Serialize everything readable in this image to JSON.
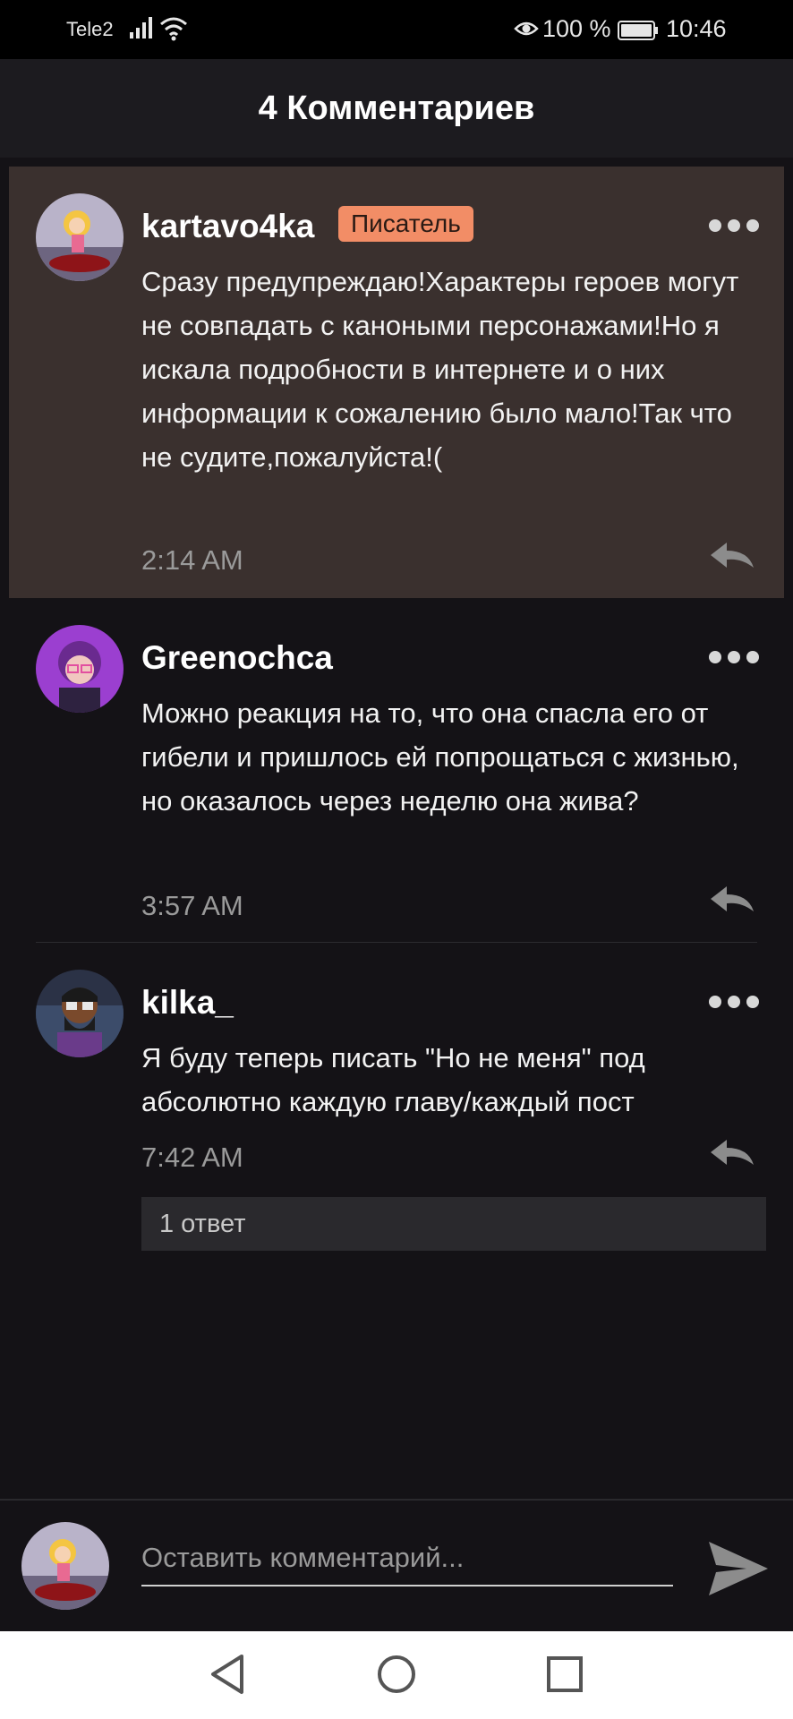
{
  "status_bar": {
    "carrier": "Tele2",
    "battery_percent": "100 %",
    "time": "10:46"
  },
  "header": {
    "title": "4 Комментариев"
  },
  "comments": [
    {
      "username": "kartavo4ka",
      "badge": "Писатель",
      "text": "Сразу предупреждаю!Характеры героев могут не совпадать с каноными персонажами!Но я искала подробности в интернете и о них информации к сожалению было мало!Так что не судите,пожалуйста!(",
      "time": "2:14 AM"
    },
    {
      "username": "Greenochca",
      "text": "Можно реакция на то, что она спасла его от гибели и пришлось ей попрощаться с жизнью, но оказалось через неделю она жива?",
      "time": "3:57 AM"
    },
    {
      "username": "kilka_",
      "text": "Я буду теперь писать \"Но не меня\" под абсолютно каждую главу/каждый пост",
      "time": "7:42 AM",
      "replies_label": "1 ответ"
    }
  ],
  "input": {
    "placeholder": "Оставить комментарий..."
  },
  "colors": {
    "background": "#141216",
    "highlight": "#3a302e",
    "badge": "#f28d66",
    "secondary_text": "#9a9a9a"
  }
}
